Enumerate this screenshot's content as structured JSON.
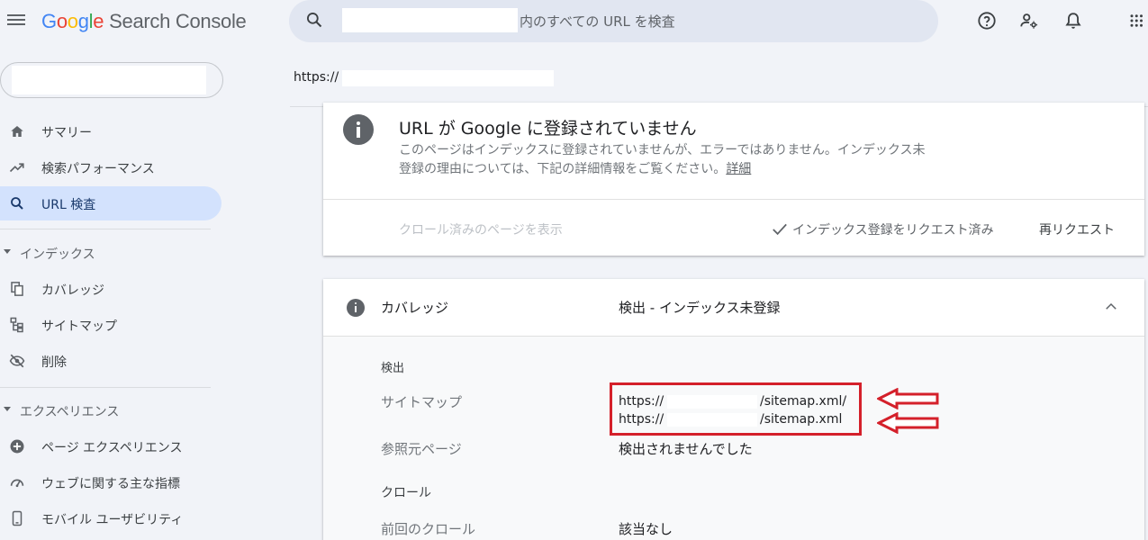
{
  "header": {
    "logo_letters": [
      "G",
      "o",
      "o",
      "g",
      "l",
      "e"
    ],
    "product_name": "Search Console",
    "search_placeholder": "内のすべての URL を検査"
  },
  "sidebar": {
    "nav_top": [
      {
        "label": "サマリー",
        "icon": "home-icon"
      },
      {
        "label": "検索パフォーマンス",
        "icon": "trending-up-icon"
      },
      {
        "label": "URL 検査",
        "icon": "search-icon",
        "active": true
      }
    ],
    "section_index": "インデックス",
    "nav_index": [
      {
        "label": "カバレッジ",
        "icon": "copy-icon"
      },
      {
        "label": "サイトマップ",
        "icon": "sitemap-icon"
      },
      {
        "label": "削除",
        "icon": "eye-off-icon"
      }
    ],
    "section_experience": "エクスペリエンス",
    "nav_experience": [
      {
        "label": "ページ エクスペリエンス",
        "icon": "plus-circle-icon"
      },
      {
        "label": "ウェブに関する主な指標",
        "icon": "gauge-icon"
      },
      {
        "label": "モバイル ユーザビリティ",
        "icon": "phone-icon"
      }
    ]
  },
  "main": {
    "inspected_url_prefix": "https://",
    "status_card": {
      "title": "URL が Google に登録されていません",
      "description": "このページはインデックスに登録されていませんが、エラーではありません。インデックス未登録の理由については、下記の詳細情報をご覧ください。",
      "details_link": "詳細",
      "crawled_link": "クロール済みのページを表示",
      "requested_label": "インデックス登録をリクエスト済み",
      "rerequest_label": "再リクエスト"
    },
    "coverage_card": {
      "label": "カバレッジ",
      "value": "検出 - インデックス未登録",
      "discovery_heading": "検出",
      "sitemap_label": "サイトマップ",
      "sitemaps": [
        {
          "prefix": "https://",
          "suffix": "/sitemap.xml/"
        },
        {
          "prefix": "https://",
          "suffix": "/sitemap.xml"
        }
      ],
      "referring_label": "参照元ページ",
      "referring_value": "検出されませんでした",
      "crawl_heading": "クロール",
      "last_crawl_label": "前回のクロール",
      "last_crawl_value": "該当なし"
    }
  },
  "colors": {
    "background": "#f1f3f8",
    "active_nav": "#d3e2fd",
    "annotation_red": "#d4202a"
  }
}
